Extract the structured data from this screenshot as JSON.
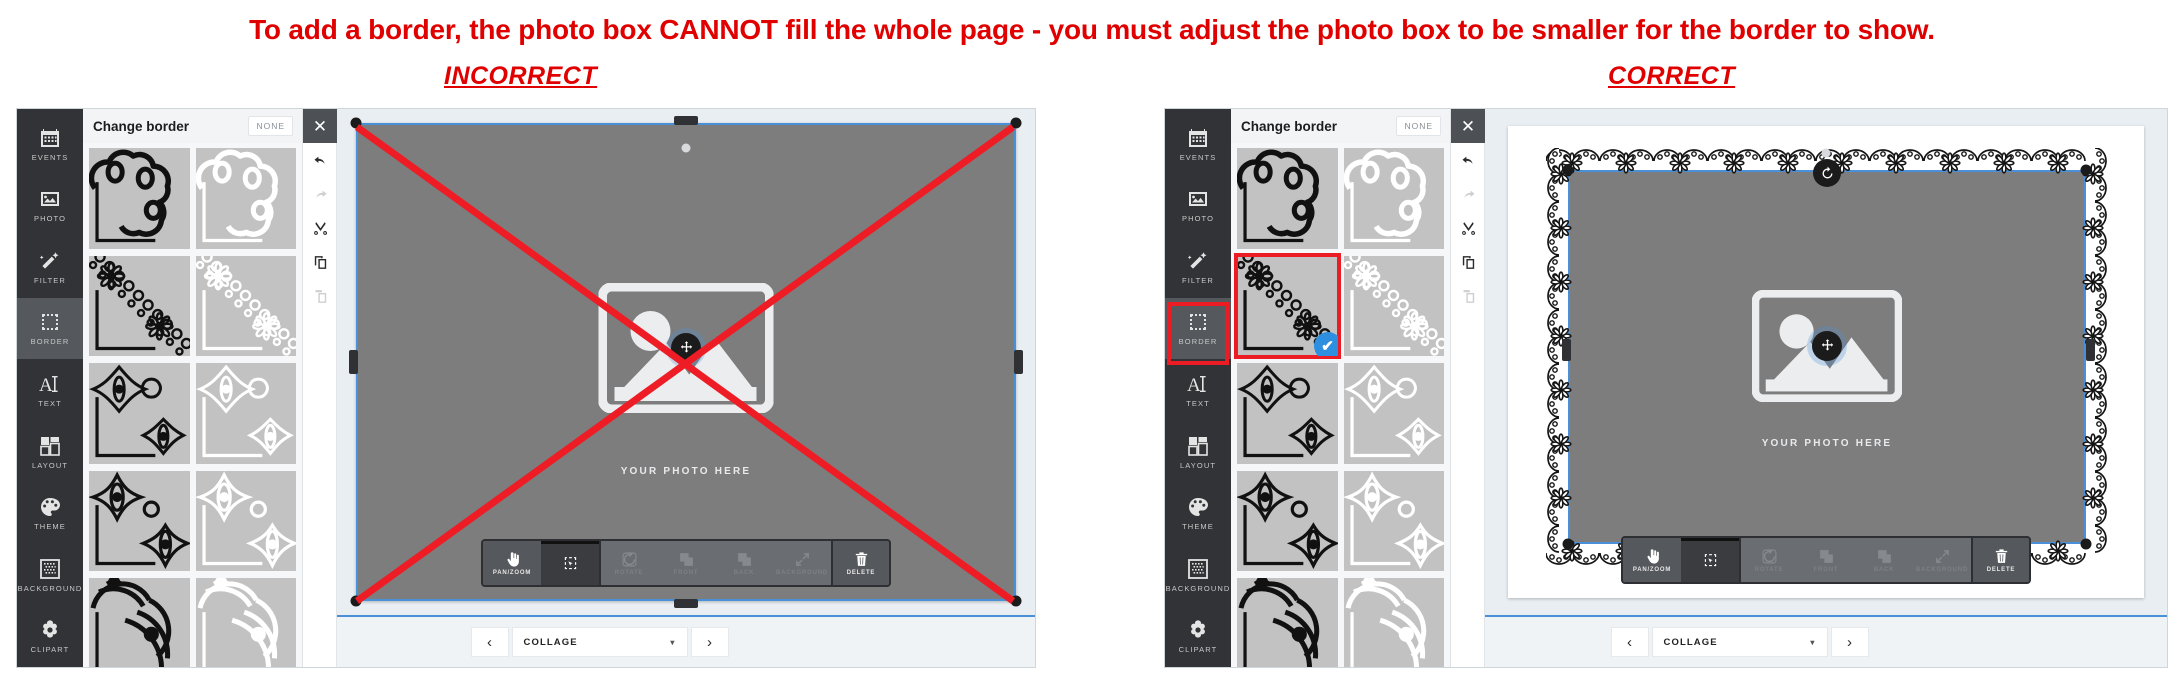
{
  "header": {
    "headline": "To add a border, the photo box CANNOT fill the whole page - you must adjust the photo box to be smaller for the border to show.",
    "incorrect_label": "INCORRECT",
    "correct_label": "CORRECT",
    "accent_color": "#e00000"
  },
  "sidebar": {
    "items": [
      {
        "label": "EVENTS",
        "icon": "calendar-icon"
      },
      {
        "label": "PHOTO",
        "icon": "photo-icon"
      },
      {
        "label": "FILTER",
        "icon": "magic-wand-icon"
      },
      {
        "label": "BORDER",
        "icon": "border-icon"
      },
      {
        "label": "TEXT",
        "icon": "text-icon"
      },
      {
        "label": "LAYOUT",
        "icon": "layout-icon"
      },
      {
        "label": "THEME",
        "icon": "palette-icon"
      },
      {
        "label": "BACKGROUND",
        "icon": "background-icon"
      },
      {
        "label": "CLIPART",
        "icon": "flower-icon"
      }
    ],
    "active": "BORDER"
  },
  "picker": {
    "title": "Change border",
    "none_label": "NONE",
    "thumbnails": [
      {
        "style": "bubble",
        "tone": "black"
      },
      {
        "style": "bubble",
        "tone": "white"
      },
      {
        "style": "daisy-lace",
        "tone": "black"
      },
      {
        "style": "daisy-lace",
        "tone": "white"
      },
      {
        "style": "petal-crest",
        "tone": "black"
      },
      {
        "style": "petal-crest",
        "tone": "white"
      },
      {
        "style": "fan-floral",
        "tone": "black"
      },
      {
        "style": "fan-floral",
        "tone": "white"
      },
      {
        "style": "crown-mandala",
        "tone": "black"
      },
      {
        "style": "crown-mandala",
        "tone": "white"
      }
    ],
    "selected_index_right": 2,
    "selected_check": "✔"
  },
  "minibar": {
    "close_label": "✕",
    "buttons": [
      {
        "name": "undo",
        "enabled": true
      },
      {
        "name": "redo",
        "enabled": false
      },
      {
        "name": "cut",
        "enabled": true
      },
      {
        "name": "copy",
        "enabled": true
      },
      {
        "name": "paste",
        "enabled": false
      }
    ]
  },
  "canvas": {
    "photo_caption": "YOUR PHOTO HERE",
    "selection_color": "#4a90d9",
    "photo_fill": "#7d7d7d"
  },
  "objbar": {
    "buttons": [
      {
        "label": "PAN/ZOOM",
        "icon": "hand-icon",
        "state": "active"
      },
      {
        "label": "",
        "icon": "select-icon",
        "state": "on"
      },
      {
        "label": "ROTATE",
        "icon": "rotate-icon",
        "state": "disabled"
      },
      {
        "label": "FRONT",
        "icon": "front-icon",
        "state": "disabled"
      },
      {
        "label": "BACK",
        "icon": "back-icon",
        "state": "disabled"
      },
      {
        "label": "BACKGROUND",
        "icon": "expand-icon",
        "state": "disabled"
      },
      {
        "label": "DELETE",
        "icon": "trash-icon",
        "state": "enabled"
      }
    ]
  },
  "pagenav": {
    "prev_label": "‹",
    "next_label": "›",
    "page_name": "COLLAGE",
    "caret": "▾"
  }
}
